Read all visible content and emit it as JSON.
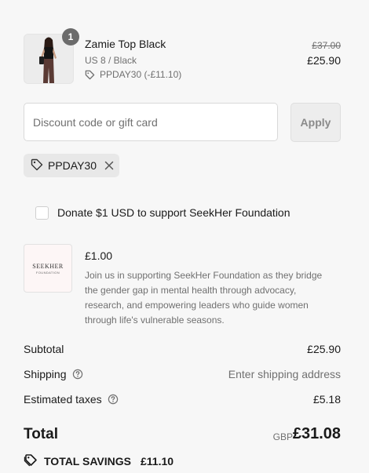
{
  "product": {
    "quantity": "1",
    "title": "Zamie Top Black",
    "variant": "US 8 / Black",
    "discount": "PPDAY30 (-£11.10)",
    "original_price": "£37.00",
    "price": "£25.90"
  },
  "discount": {
    "placeholder": "Discount code or gift card",
    "apply_label": "Apply",
    "applied_code": "PPDAY30"
  },
  "donation": {
    "checkbox_label": "Donate $1 USD to support SeekHer Foundation",
    "logo_line1": "SEEKHER",
    "logo_line2": "FOUNDATION",
    "price": "£1.00",
    "description": "Join us in supporting SeekHer Foundation as they bridge the gender gap in mental health through advocacy, research, and empowering leaders who guide women through life's vulnerable seasons."
  },
  "summary": {
    "subtotal_label": "Subtotal",
    "subtotal_value": "£25.90",
    "shipping_label": "Shipping",
    "shipping_value": "Enter shipping address",
    "taxes_label": "Estimated taxes",
    "taxes_value": "£5.18",
    "total_label": "Total",
    "currency": "GBP",
    "total_value": "£31.08",
    "savings_label": "TOTAL SAVINGS",
    "savings_value": "£11.10"
  }
}
